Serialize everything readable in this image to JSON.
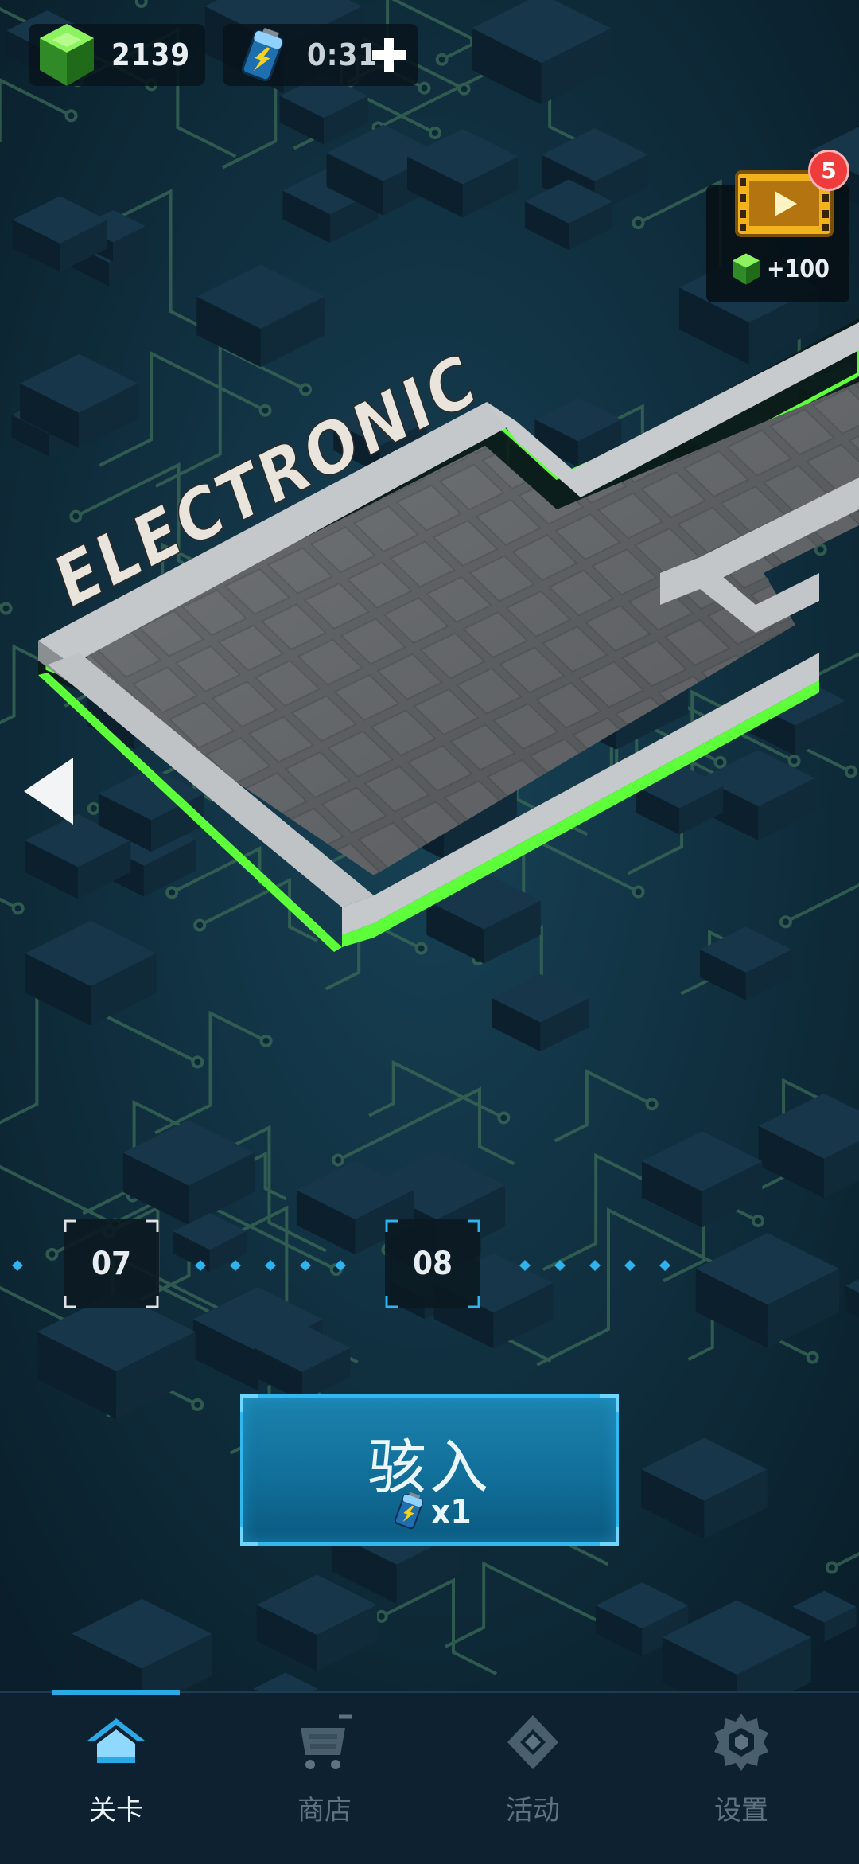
{
  "hud": {
    "gems": "2139",
    "energy_timer": "0:31"
  },
  "world": {
    "title": "ELECTRONIC"
  },
  "video_reward": {
    "badge_count": "5",
    "reward": "+100"
  },
  "levels": {
    "items": [
      {
        "label": "07",
        "state": "completed"
      },
      {
        "label": "08",
        "state": "current"
      }
    ]
  },
  "start_button": {
    "label": "骇入",
    "cost": "x1"
  },
  "nav": {
    "tabs": [
      {
        "label": "关卡",
        "icon": "home-icon",
        "active": true
      },
      {
        "label": "商店",
        "icon": "cart-icon",
        "active": false
      },
      {
        "label": "活动",
        "icon": "diamond-icon",
        "active": false
      },
      {
        "label": "设置",
        "icon": "gear-icon",
        "active": false
      }
    ]
  },
  "colors": {
    "accent": "#29a9e6",
    "neon_green": "#5dff3a",
    "background": "#0c2634"
  }
}
